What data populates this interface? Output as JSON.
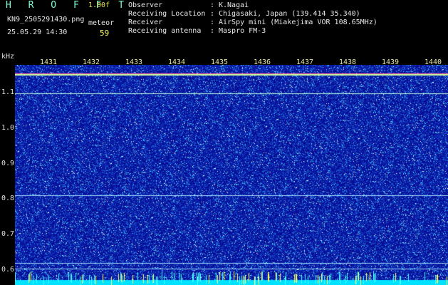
{
  "header": {
    "logo": "H R O F F T",
    "version": "1.00f",
    "filename": "KN9_2505291430.png",
    "meteor_label": "meteor",
    "datetime": "25.05.29 14:30",
    "meteor_count": "59"
  },
  "info": [
    {
      "key": "Observer",
      "value": "K.Nagai"
    },
    {
      "key": "Receiving Location",
      "value": "Chigasaki, Japan (139.414 35.340)"
    },
    {
      "key": "Receiver",
      "value": "AirSpy mini (Miakejima VOR 108.65MHz)"
    },
    {
      "key": "Receiving antenna",
      "value": "Maspro FM-3"
    }
  ],
  "axis": {
    "unit": "kHz",
    "y_ticks": [
      "1.1",
      "1.0",
      "0.9",
      "0.8",
      "0.7",
      "0.6"
    ],
    "time_ticks": [
      "1431",
      "1432",
      "1433",
      "1434",
      "1435",
      "1436",
      "1437",
      "1438",
      "1439",
      "1440"
    ]
  },
  "colors": {
    "background": "#0a0e9a",
    "carrier": "#e0ffe0",
    "bottom_band": "#00e0ff"
  }
}
